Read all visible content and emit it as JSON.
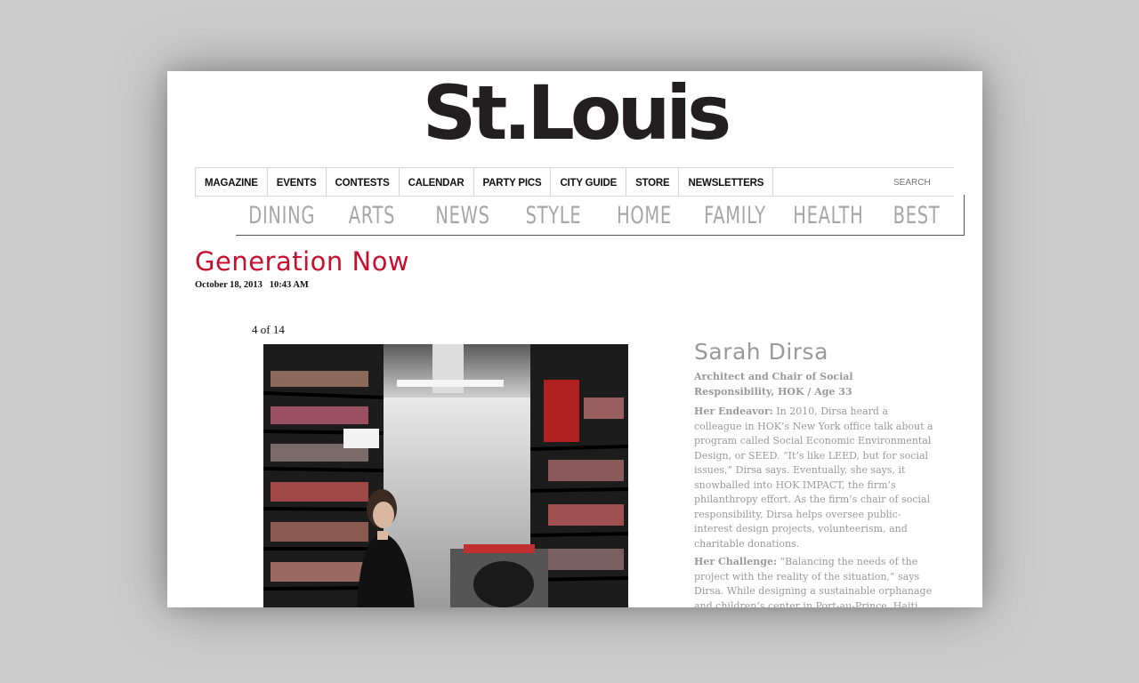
{
  "brand": {
    "logo_text": "St.Louis"
  },
  "top_nav": {
    "items": [
      "MAGAZINE",
      "EVENTS",
      "CONTESTS",
      "CALENDAR",
      "PARTY PICS",
      "CITY GUIDE",
      "STORE",
      "NEWSLETTERS"
    ],
    "search_placeholder": "SEARCH"
  },
  "section_nav": {
    "items": [
      "DINING",
      "ARTS",
      "NEWS",
      "STYLE",
      "HOME",
      "FAMILY",
      "HEALTH",
      "BEST"
    ]
  },
  "article": {
    "title": "Generation Now",
    "date": "October 18, 2013",
    "time": "10:43 AM"
  },
  "gallery": {
    "counter": "4 of 14"
  },
  "profile": {
    "name": "Sarah Dirsa",
    "role": "Architect and Chair of Social Responsibility, HOK / Age 33",
    "endeavor_label": "Her Endeavor:",
    "endeavor_text": " In 2010, Dirsa heard a colleague in HOK’s New York office talk about a program called Social Economic Environmental Design, or SEED. “It’s like LEED, but for social issues,” Dirsa says. Eventually, she says, it snowballed into HOK IMPACT, the firm’s philanthropy effort. As the firm’s chair of social responsibility, Dirsa helps oversee public-interest design projects, volunteerism, and charitable donations.",
    "challenge_label": "Her Challenge:",
    "challenge_text": " “Balancing the needs of the project with the reality of the situation,” says Dirsa. While designing a sustainable orphanage and children’s center in Port-au-Prince, Haiti,"
  },
  "colors": {
    "title_red": "#c8102e",
    "nav_gray": "#a6a6a6",
    "backdrop": "#cdcdcd"
  }
}
